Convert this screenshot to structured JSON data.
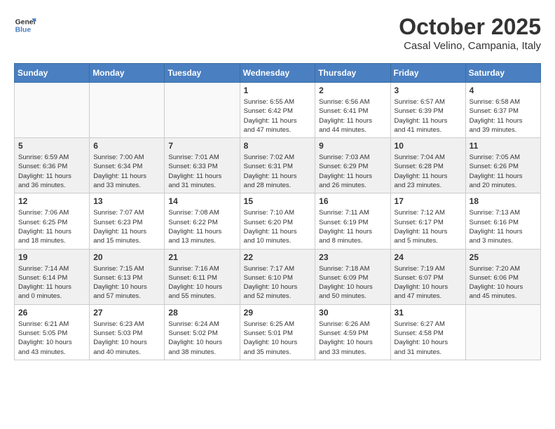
{
  "header": {
    "logo_line1": "General",
    "logo_line2": "Blue",
    "month_title": "October 2025",
    "location": "Casal Velino, Campania, Italy"
  },
  "days_of_week": [
    "Sunday",
    "Monday",
    "Tuesday",
    "Wednesday",
    "Thursday",
    "Friday",
    "Saturday"
  ],
  "weeks": [
    [
      {
        "day": "",
        "info": ""
      },
      {
        "day": "",
        "info": ""
      },
      {
        "day": "",
        "info": ""
      },
      {
        "day": "1",
        "info": "Sunrise: 6:55 AM\nSunset: 6:42 PM\nDaylight: 11 hours\nand 47 minutes."
      },
      {
        "day": "2",
        "info": "Sunrise: 6:56 AM\nSunset: 6:41 PM\nDaylight: 11 hours\nand 44 minutes."
      },
      {
        "day": "3",
        "info": "Sunrise: 6:57 AM\nSunset: 6:39 PM\nDaylight: 11 hours\nand 41 minutes."
      },
      {
        "day": "4",
        "info": "Sunrise: 6:58 AM\nSunset: 6:37 PM\nDaylight: 11 hours\nand 39 minutes."
      }
    ],
    [
      {
        "day": "5",
        "info": "Sunrise: 6:59 AM\nSunset: 6:36 PM\nDaylight: 11 hours\nand 36 minutes."
      },
      {
        "day": "6",
        "info": "Sunrise: 7:00 AM\nSunset: 6:34 PM\nDaylight: 11 hours\nand 33 minutes."
      },
      {
        "day": "7",
        "info": "Sunrise: 7:01 AM\nSunset: 6:33 PM\nDaylight: 11 hours\nand 31 minutes."
      },
      {
        "day": "8",
        "info": "Sunrise: 7:02 AM\nSunset: 6:31 PM\nDaylight: 11 hours\nand 28 minutes."
      },
      {
        "day": "9",
        "info": "Sunrise: 7:03 AM\nSunset: 6:29 PM\nDaylight: 11 hours\nand 26 minutes."
      },
      {
        "day": "10",
        "info": "Sunrise: 7:04 AM\nSunset: 6:28 PM\nDaylight: 11 hours\nand 23 minutes."
      },
      {
        "day": "11",
        "info": "Sunrise: 7:05 AM\nSunset: 6:26 PM\nDaylight: 11 hours\nand 20 minutes."
      }
    ],
    [
      {
        "day": "12",
        "info": "Sunrise: 7:06 AM\nSunset: 6:25 PM\nDaylight: 11 hours\nand 18 minutes."
      },
      {
        "day": "13",
        "info": "Sunrise: 7:07 AM\nSunset: 6:23 PM\nDaylight: 11 hours\nand 15 minutes."
      },
      {
        "day": "14",
        "info": "Sunrise: 7:08 AM\nSunset: 6:22 PM\nDaylight: 11 hours\nand 13 minutes."
      },
      {
        "day": "15",
        "info": "Sunrise: 7:10 AM\nSunset: 6:20 PM\nDaylight: 11 hours\nand 10 minutes."
      },
      {
        "day": "16",
        "info": "Sunrise: 7:11 AM\nSunset: 6:19 PM\nDaylight: 11 hours\nand 8 minutes."
      },
      {
        "day": "17",
        "info": "Sunrise: 7:12 AM\nSunset: 6:17 PM\nDaylight: 11 hours\nand 5 minutes."
      },
      {
        "day": "18",
        "info": "Sunrise: 7:13 AM\nSunset: 6:16 PM\nDaylight: 11 hours\nand 3 minutes."
      }
    ],
    [
      {
        "day": "19",
        "info": "Sunrise: 7:14 AM\nSunset: 6:14 PM\nDaylight: 11 hours\nand 0 minutes."
      },
      {
        "day": "20",
        "info": "Sunrise: 7:15 AM\nSunset: 6:13 PM\nDaylight: 10 hours\nand 57 minutes."
      },
      {
        "day": "21",
        "info": "Sunrise: 7:16 AM\nSunset: 6:11 PM\nDaylight: 10 hours\nand 55 minutes."
      },
      {
        "day": "22",
        "info": "Sunrise: 7:17 AM\nSunset: 6:10 PM\nDaylight: 10 hours\nand 52 minutes."
      },
      {
        "day": "23",
        "info": "Sunrise: 7:18 AM\nSunset: 6:09 PM\nDaylight: 10 hours\nand 50 minutes."
      },
      {
        "day": "24",
        "info": "Sunrise: 7:19 AM\nSunset: 6:07 PM\nDaylight: 10 hours\nand 47 minutes."
      },
      {
        "day": "25",
        "info": "Sunrise: 7:20 AM\nSunset: 6:06 PM\nDaylight: 10 hours\nand 45 minutes."
      }
    ],
    [
      {
        "day": "26",
        "info": "Sunrise: 6:21 AM\nSunset: 5:05 PM\nDaylight: 10 hours\nand 43 minutes."
      },
      {
        "day": "27",
        "info": "Sunrise: 6:23 AM\nSunset: 5:03 PM\nDaylight: 10 hours\nand 40 minutes."
      },
      {
        "day": "28",
        "info": "Sunrise: 6:24 AM\nSunset: 5:02 PM\nDaylight: 10 hours\nand 38 minutes."
      },
      {
        "day": "29",
        "info": "Sunrise: 6:25 AM\nSunset: 5:01 PM\nDaylight: 10 hours\nand 35 minutes."
      },
      {
        "day": "30",
        "info": "Sunrise: 6:26 AM\nSunset: 4:59 PM\nDaylight: 10 hours\nand 33 minutes."
      },
      {
        "day": "31",
        "info": "Sunrise: 6:27 AM\nSunset: 4:58 PM\nDaylight: 10 hours\nand 31 minutes."
      },
      {
        "day": "",
        "info": ""
      }
    ]
  ]
}
